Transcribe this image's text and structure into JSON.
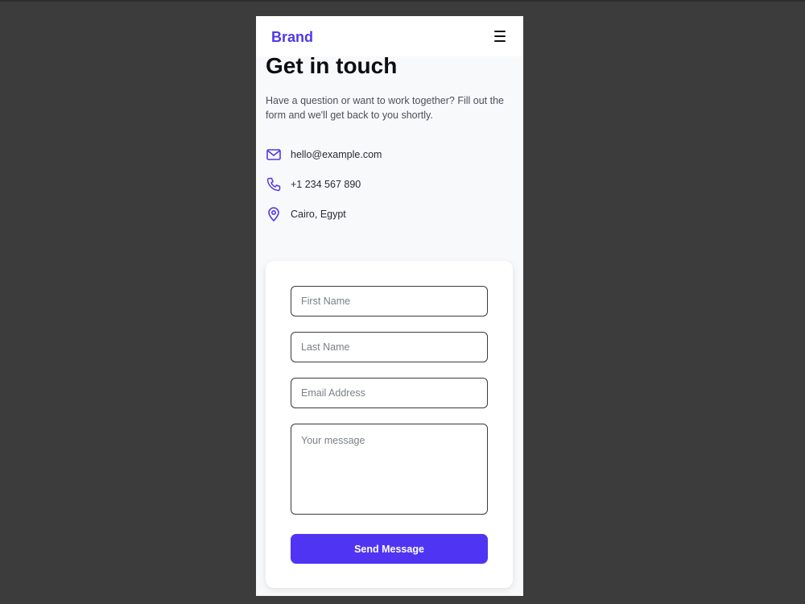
{
  "navbar": {
    "brand": "Brand",
    "menu_icon": "hamburger-menu-icon"
  },
  "hero": {
    "title": "Get in touch",
    "intro": "Have a question or want to work together? Fill out the form and we'll get back to you shortly."
  },
  "contact": {
    "items": [
      {
        "icon": "mail-icon",
        "text": "hello@example.com"
      },
      {
        "icon": "phone-icon",
        "text": "+1 234 567 890"
      },
      {
        "icon": "location-pin-icon",
        "text": "Cairo, Egypt"
      }
    ]
  },
  "form": {
    "first_name": {
      "placeholder": "First Name",
      "value": ""
    },
    "last_name": {
      "placeholder": "Last Name",
      "value": ""
    },
    "email": {
      "placeholder": "Email Address",
      "value": ""
    },
    "message": {
      "placeholder": "Your message",
      "value": ""
    },
    "submit_label": "Send Message"
  },
  "colors": {
    "accent": "#4f35f3",
    "brand": "#4f3ae6",
    "page_bg": "#f8f9fb",
    "outer_bg": "#3c3c3c"
  }
}
